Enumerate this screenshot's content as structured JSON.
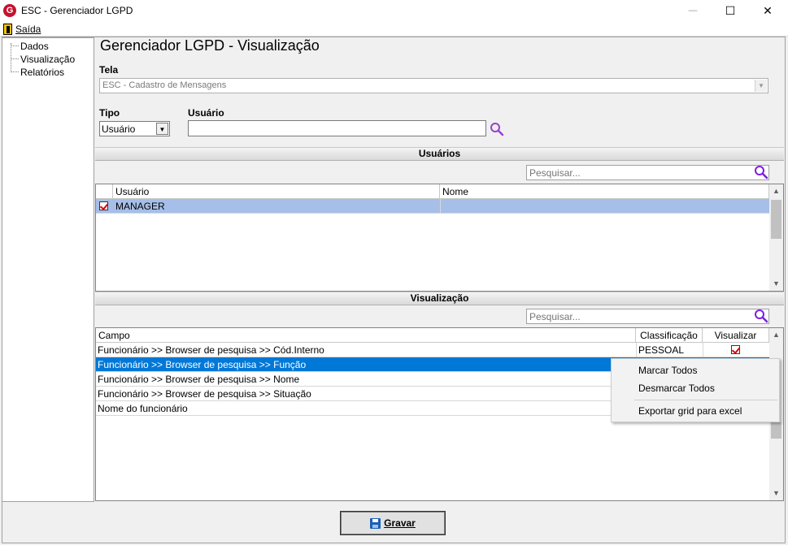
{
  "window": {
    "title": "ESC - Gerenciador LGPD",
    "icon_letter": "G",
    "minimize": "—",
    "maximize": "☐",
    "close": "✕"
  },
  "menu": {
    "exit_label": "Saída"
  },
  "tree": {
    "items": [
      "Dados",
      "Visualização",
      "Relatórios"
    ]
  },
  "page": {
    "title": "Gerenciador LGPD - Visualização"
  },
  "form": {
    "tela_label": "Tela",
    "tela_value": "ESC - Cadastro de Mensagens",
    "tipo_label": "Tipo",
    "tipo_value": "Usuário",
    "usuario_label": "Usuário",
    "usuario_value": ""
  },
  "usuarios_section": {
    "title": "Usuários",
    "search_placeholder": "Pesquisar...",
    "columns": [
      "Usuário",
      "Nome"
    ],
    "rows": [
      {
        "checked": true,
        "usuario": "MANAGER",
        "nome": ""
      }
    ]
  },
  "visualizacao_section": {
    "title": "Visualização",
    "search_placeholder": "Pesquisar...",
    "columns": [
      "Campo",
      "Classificação",
      "Visualizar"
    ],
    "rows": [
      {
        "campo": "Funcionário >> Browser de pesquisa >> Cód.Interno",
        "classificacao": "PESSOAL",
        "visualizar": true
      },
      {
        "campo": "Funcionário >> Browser de pesquisa >> Função",
        "classificacao": "",
        "visualizar": false
      },
      {
        "campo": "Funcionário >> Browser de pesquisa >> Nome",
        "classificacao": "",
        "visualizar": false
      },
      {
        "campo": "Funcionário >> Browser de pesquisa >> Situação",
        "classificacao": "",
        "visualizar": false
      },
      {
        "campo": "Nome do funcionário",
        "classificacao": "",
        "visualizar": false
      }
    ]
  },
  "context_menu": {
    "items": [
      "Marcar Todos",
      "Desmarcar Todos",
      "Exportar grid para excel"
    ]
  },
  "footer": {
    "save_label": "Gravar"
  },
  "colors": {
    "selection": "#0078d7",
    "selection_light": "#a6bfe8",
    "search_icon": "#8a2be2"
  }
}
